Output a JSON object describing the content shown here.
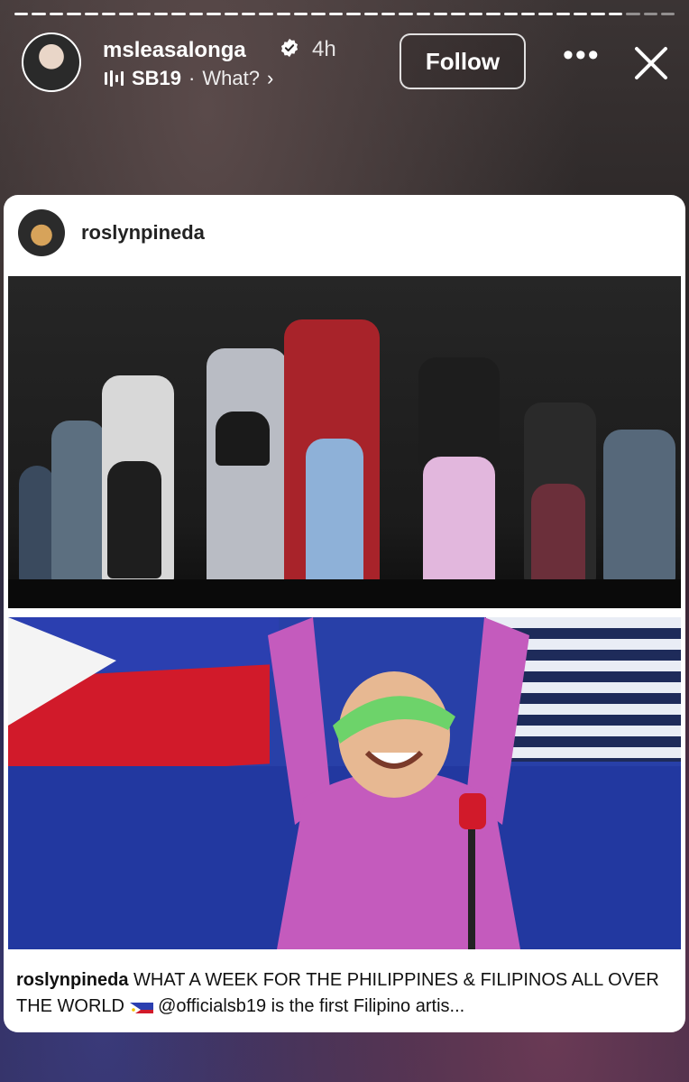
{
  "story": {
    "username": "msleasalonga",
    "time_ago": "4h",
    "music_artist": "SB19",
    "music_separator": "·",
    "music_title": "What?",
    "music_chevron": "›",
    "follow_label": "Follow",
    "more_label": "•••",
    "progress_segments": 38,
    "progress_completed": 35
  },
  "shared_post": {
    "username": "roslynpineda",
    "caption_user": "roslynpineda",
    "caption_text": "WHAT A WEEK FOR THE PHILIPPINES & FILIPINOS ALL OVER THE WORLD",
    "caption_rest": "@officialsb19 is the first Filipino artis..."
  },
  "colors": {
    "flag_blue": "#2b3fb0",
    "flag_red": "#d11a2a",
    "visor_green": "#6dd36a",
    "jacket_pink": "#c45bbd"
  },
  "icons": [
    "verified-badge-icon",
    "music-bars-icon",
    "more-icon",
    "close-icon",
    "philippines-flag-emoji"
  ]
}
